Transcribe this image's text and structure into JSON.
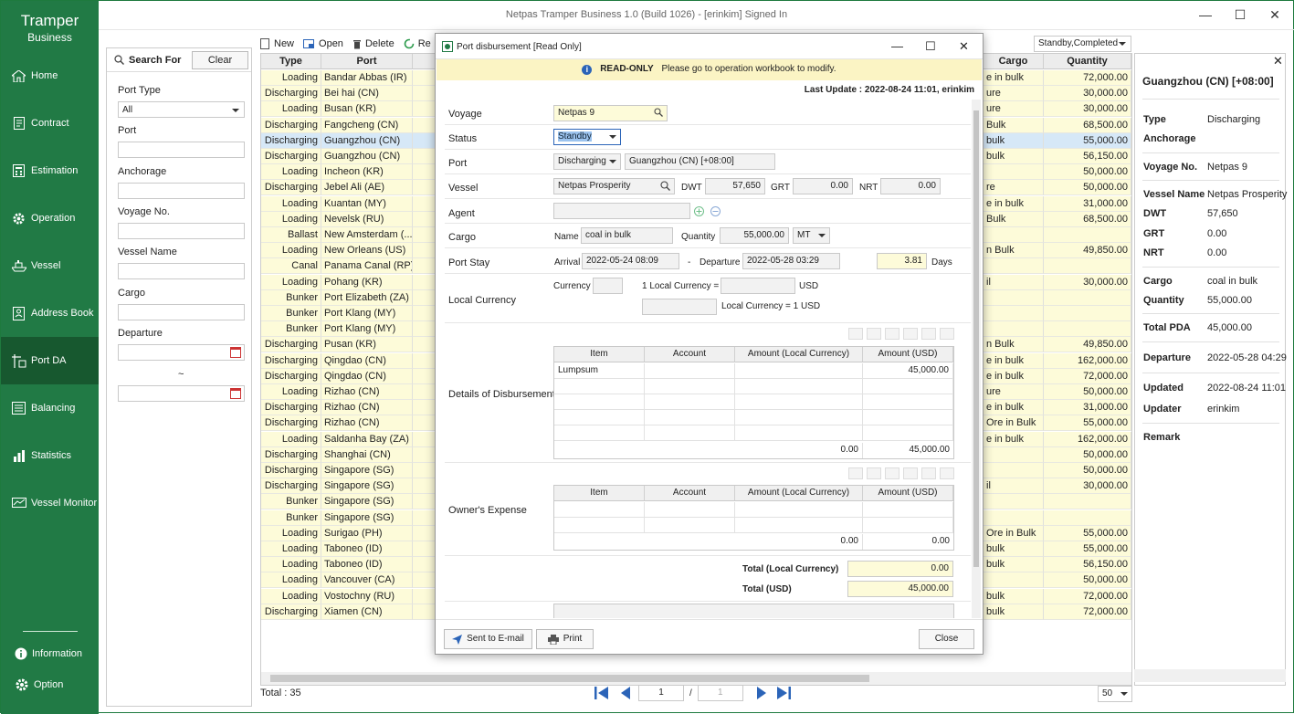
{
  "app": {
    "brand_line1": "Tramper",
    "brand_line2": "Business",
    "window_title": "Netpas Tramper Business 1.0 (Build 1026) - [erinkim] Signed In"
  },
  "nav": [
    {
      "label": "Home",
      "icon": "home-icon"
    },
    {
      "label": "Contract",
      "icon": "contract-icon"
    },
    {
      "label": "Estimation",
      "icon": "calculator-icon"
    },
    {
      "label": "Operation",
      "icon": "gear-icon"
    },
    {
      "label": "Vessel",
      "icon": "ship-icon"
    },
    {
      "label": "Address Book",
      "icon": "address-book-icon"
    },
    {
      "label": "Port DA",
      "icon": "port-icon"
    },
    {
      "label": "Balancing",
      "icon": "balance-icon"
    },
    {
      "label": "Statistics",
      "icon": "chart-icon"
    },
    {
      "label": "Vessel Monitor",
      "icon": "monitor-icon"
    }
  ],
  "sidebar_bottom": {
    "information": "Information",
    "option": "Option"
  },
  "search": {
    "title": "Search For",
    "clear": "Clear",
    "port_type_label": "Port Type",
    "port_type_value": "All",
    "port_label": "Port",
    "anchorage_label": "Anchorage",
    "voyage_label": "Voyage No.",
    "vessel_label": "Vessel Name",
    "cargo_label": "Cargo",
    "departure_label": "Departure",
    "range_sep": "~"
  },
  "toolbar": {
    "new": "New",
    "open": "Open",
    "delete": "Delete",
    "refresh": "Re"
  },
  "filter_value": "Standby,Completed",
  "grid": {
    "headers": {
      "type": "Type",
      "port": "Port",
      "cargo": "Cargo",
      "quantity": "Quantity"
    },
    "rows": [
      [
        "Loading",
        "Bandar Abbas (IR)",
        "e in bulk",
        "72,000.00"
      ],
      [
        "Discharging",
        "Bei hai (CN)",
        "ure",
        "30,000.00"
      ],
      [
        "Loading",
        "Busan (KR)",
        "ure",
        "30,000.00"
      ],
      [
        "Discharging",
        "Fangcheng (CN)",
        "Bulk",
        "68,500.00"
      ],
      [
        "Discharging",
        "Guangzhou (CN)",
        "bulk",
        "55,000.00"
      ],
      [
        "Discharging",
        "Guangzhou (CN)",
        "bulk",
        "56,150.00"
      ],
      [
        "Loading",
        "Incheon (KR)",
        "",
        "50,000.00"
      ],
      [
        "Discharging",
        "Jebel Ali (AE)",
        "re",
        "50,000.00"
      ],
      [
        "Loading",
        "Kuantan (MY)",
        "e in bulk",
        "31,000.00"
      ],
      [
        "Loading",
        "Nevelsk (RU)",
        "Bulk",
        "68,500.00"
      ],
      [
        "Ballast",
        "New Amsterdam (...",
        "",
        ""
      ],
      [
        "Loading",
        "New Orleans (US)",
        "n Bulk",
        "49,850.00"
      ],
      [
        "Canal",
        "Panama Canal (RP)",
        "",
        ""
      ],
      [
        "Loading",
        "Pohang (KR)",
        "il",
        "30,000.00"
      ],
      [
        "Bunker",
        "Port Elizabeth (ZA)",
        "",
        ""
      ],
      [
        "Bunker",
        "Port Klang (MY)",
        "",
        ""
      ],
      [
        "Bunker",
        "Port Klang (MY)",
        "",
        ""
      ],
      [
        "Discharging",
        "Pusan (KR)",
        "n Bulk",
        "49,850.00"
      ],
      [
        "Discharging",
        "Qingdao (CN)",
        "e in bulk",
        "162,000.00"
      ],
      [
        "Discharging",
        "Qingdao (CN)",
        "e in bulk",
        "72,000.00"
      ],
      [
        "Loading",
        "Rizhao (CN)",
        "ure",
        "50,000.00"
      ],
      [
        "Discharging",
        "Rizhao (CN)",
        "e in bulk",
        "31,000.00"
      ],
      [
        "Discharging",
        "Rizhao (CN)",
        "Ore in Bulk",
        "55,000.00"
      ],
      [
        "Loading",
        "Saldanha Bay (ZA)",
        "e in bulk",
        "162,000.00"
      ],
      [
        "Discharging",
        "Shanghai (CN)",
        "",
        "50,000.00"
      ],
      [
        "Discharging",
        "Singapore (SG)",
        "",
        "50,000.00"
      ],
      [
        "Discharging",
        "Singapore (SG)",
        "il",
        "30,000.00"
      ],
      [
        "Bunker",
        "Singapore (SG)",
        "",
        ""
      ],
      [
        "Bunker",
        "Singapore (SG)",
        "",
        ""
      ],
      [
        "Loading",
        "Surigao (PH)",
        "Ore in Bulk",
        "55,000.00"
      ],
      [
        "Loading",
        "Taboneo (ID)",
        "bulk",
        "55,000.00"
      ],
      [
        "Loading",
        "Taboneo (ID)",
        "bulk",
        "56,150.00"
      ],
      [
        "Loading",
        "Vancouver (CA)",
        "",
        "50,000.00"
      ],
      [
        "Loading",
        "Vostochny (RU)",
        "bulk",
        "72,000.00"
      ],
      [
        "Discharging",
        "Xiamen (CN)",
        "bulk",
        "72,000.00"
      ]
    ],
    "selected_index": 4
  },
  "footer": {
    "total": "Total : 35",
    "page": "1",
    "sep": "/",
    "pages": "1",
    "per_page": "50"
  },
  "detail": {
    "title": "Guangzhou (CN) [+08:00]",
    "type_k": "Type",
    "type_v": "Discharging",
    "anchorage_k": "Anchorage",
    "voyage_k": "Voyage No.",
    "voyage_v": "Netpas 9",
    "vessel_k": "Vessel Name",
    "vessel_v": "Netpas Prosperity",
    "dwt_k": "DWT",
    "dwt_v": "57,650",
    "grt_k": "GRT",
    "grt_v": "0.00",
    "nrt_k": "NRT",
    "nrt_v": "0.00",
    "cargo_k": "Cargo",
    "cargo_v": "coal in bulk",
    "qty_k": "Quantity",
    "qty_v": "55,000.00",
    "pda_k": "Total PDA",
    "pda_v": "45,000.00",
    "dep_k": "Departure",
    "dep_v": "2022-05-28 04:29",
    "upd_k": "Updated",
    "upd_v": "2022-08-24 11:01",
    "updr_k": "Updater",
    "updr_v": "erinkim",
    "remark_k": "Remark"
  },
  "modal": {
    "title": "Port disbursement [Read Only]",
    "ro_label": "READ-ONLY",
    "ro_msg": "Please go to operation workbook to modify.",
    "last_update": "Last Update : 2022-08-24 11:01, erinkim",
    "voyage_label": "Voyage",
    "voyage_value": "Netpas 9",
    "status_label": "Status",
    "status_value": "Standby",
    "port_label": "Port",
    "port_type": "Discharging",
    "port_value": "Guangzhou (CN) [+08:00]",
    "vessel_label": "Vessel",
    "vessel_value": "Netpas Prosperity",
    "dwt_label": "DWT",
    "dwt_value": "57,650",
    "grt_label": "GRT",
    "grt_value": "0.00",
    "nrt_label": "NRT",
    "nrt_value": "0.00",
    "agent_label": "Agent",
    "cargo_label": "Cargo",
    "cargo_name_label": "Name",
    "cargo_name": "coal in bulk",
    "qty_label": "Quantity",
    "qty_value": "55,000.00",
    "unit": "MT",
    "stay_label": "Port Stay",
    "arrival_label": "Arrival",
    "arrival": "2022-05-24 08:09",
    "dash": "-",
    "departure_label": "Departure",
    "departure": "2022-05-28 03:29",
    "days_value": "3.81",
    "days_label": "Days",
    "lc_label": "Local Currency",
    "currency_label": "Currency",
    "one_lc": "1 Local Currency =",
    "usd": "USD",
    "lc_eq": "Local Currency = 1 USD",
    "dod_label": "Details of Disbursement",
    "col_item": "Item",
    "col_account": "Account",
    "col_amount_lc": "Amount (Local Currency)",
    "col_amount_usd": "Amount (USD)",
    "dod_item": "Lumpsum",
    "dod_item_usd": "45,000.00",
    "dod_total_lc": "0.00",
    "dod_total_usd": "45,000.00",
    "oe_label": "Owner's Expense",
    "oe_total_lc": "0.00",
    "oe_total_usd": "0.00",
    "total_lc_label": "Total (Local Currency)",
    "total_lc": "0.00",
    "total_usd_label": "Total (USD)",
    "total_usd": "45,000.00",
    "email_btn": "Sent to E-mail",
    "print_btn": "Print",
    "close_btn": "Close"
  }
}
